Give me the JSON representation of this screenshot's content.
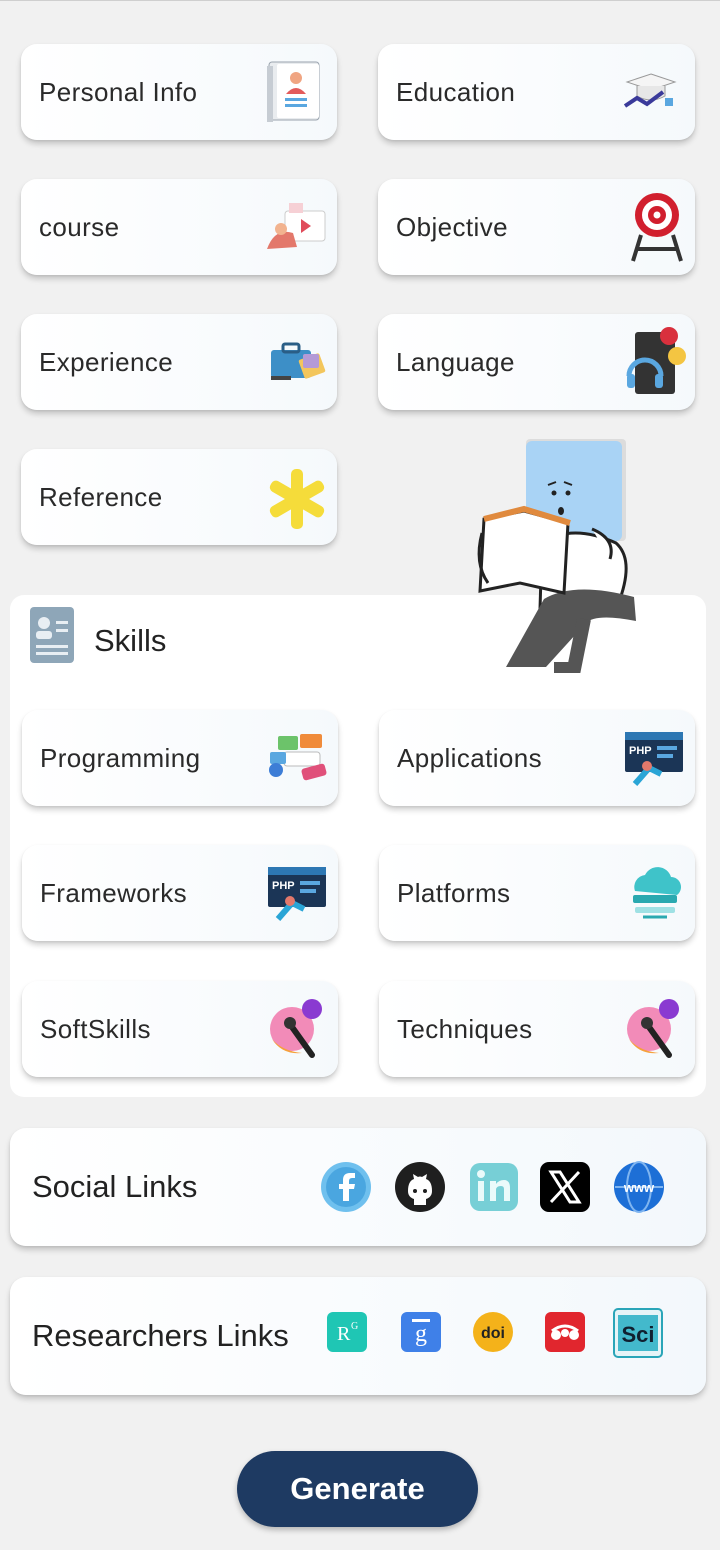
{
  "cards": {
    "personal_info": "Personal Info",
    "education": "Education",
    "course": "course",
    "objective": "Objective",
    "experience": "Experience",
    "language": "Language",
    "reference": "Reference"
  },
  "skills": {
    "title": "Skills",
    "items": {
      "programming": "Programming",
      "applications": "Applications",
      "frameworks": "Frameworks",
      "platforms": "Platforms",
      "softskills": "SoftSkills",
      "techniques": "Techniques"
    }
  },
  "social_links": {
    "title": "Social Links",
    "icons": [
      "facebook-icon",
      "github-icon",
      "linkedin-icon",
      "x-icon",
      "website-icon"
    ]
  },
  "researchers_links": {
    "title": "Researchers Links",
    "icons": [
      "researchgate-icon",
      "google-scholar-icon",
      "doi-icon",
      "mendeley-icon",
      "sciprofiles-icon"
    ],
    "glyphs": {
      "researchgate": "R",
      "researchgate_sup": "G",
      "scholar": "g",
      "doi": "doi",
      "sci": "Sci"
    }
  },
  "generate_button": "Generate",
  "colors": {
    "primary": "#1e3a62",
    "background": "#f1f1f1"
  }
}
